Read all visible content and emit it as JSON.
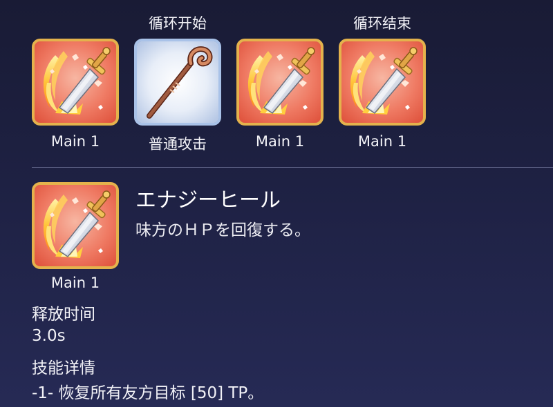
{
  "sequence": {
    "loop_start_label": "循环开始",
    "loop_end_label": "循环结束",
    "skills": [
      {
        "label": "Main 1",
        "icon": "flaming-sword-icon"
      },
      {
        "label": "普通攻击",
        "icon": "magic-staff-icon"
      },
      {
        "label": "Main 1",
        "icon": "flaming-sword-icon"
      },
      {
        "label": "Main 1",
        "icon": "flaming-sword-icon"
      }
    ]
  },
  "detail": {
    "icon_label": "Main 1",
    "icon": "flaming-sword-icon",
    "skill_name": "エナジーヒール",
    "skill_description": "味方のＨＰを回復する。",
    "cast_time_label": "释放时间",
    "cast_time_value": "3.0s",
    "details_label": "技能详情",
    "details_text": "-1- 恢复所有友方目标 [50] TP。"
  },
  "colors": {
    "background_top": "#191b35",
    "background_bottom": "#262a55",
    "blade_frame": "#e4b24c",
    "staff_frame": "#a9c2e8"
  }
}
